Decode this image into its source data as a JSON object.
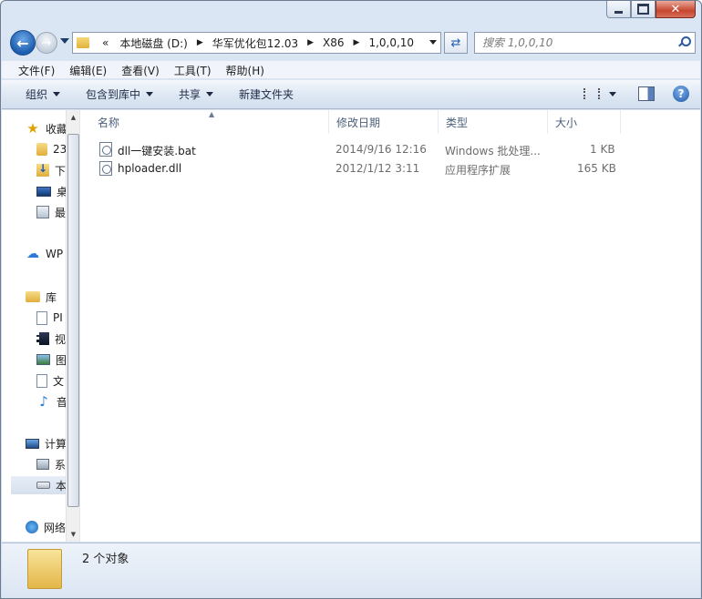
{
  "caption": {
    "close": "✕"
  },
  "nav": {
    "back": "←",
    "forward": "→",
    "breadcrumb": [
      "«",
      "本地磁盘 (D:)",
      "华军优化包12.03",
      "X86",
      "1,0,0,10"
    ],
    "search_placeholder": "搜索 1,0,0,10",
    "refresh": "⇄"
  },
  "menu": [
    "文件(F)",
    "编辑(E)",
    "查看(V)",
    "工具(T)",
    "帮助(H)"
  ],
  "toolbar": {
    "organize": "组织",
    "include_library": "包含到库中",
    "share": "共享",
    "new_folder": "新建文件夹",
    "help": "?"
  },
  "navpane": {
    "favorites": "收藏",
    "fav_items": [
      "23",
      "下",
      "桌",
      "最"
    ],
    "wps": "WP",
    "libraries": "库",
    "lib_items": [
      "PI",
      "视",
      "图",
      "文",
      "音"
    ],
    "computer": "计算",
    "pc_items": [
      "系",
      "本"
    ],
    "network": "网络"
  },
  "columns": {
    "name": "名称",
    "modified": "修改日期",
    "type": "类型",
    "size": "大小"
  },
  "files": [
    {
      "name": "dll一键安装.bat",
      "modified": "2014/9/16 12:16",
      "type": "Windows 批处理...",
      "size": "1 KB"
    },
    {
      "name": "hploader.dll",
      "modified": "2012/1/12 3:11",
      "type": "应用程序扩展",
      "size": "165 KB"
    }
  ],
  "status": {
    "count": "2 个对象"
  }
}
